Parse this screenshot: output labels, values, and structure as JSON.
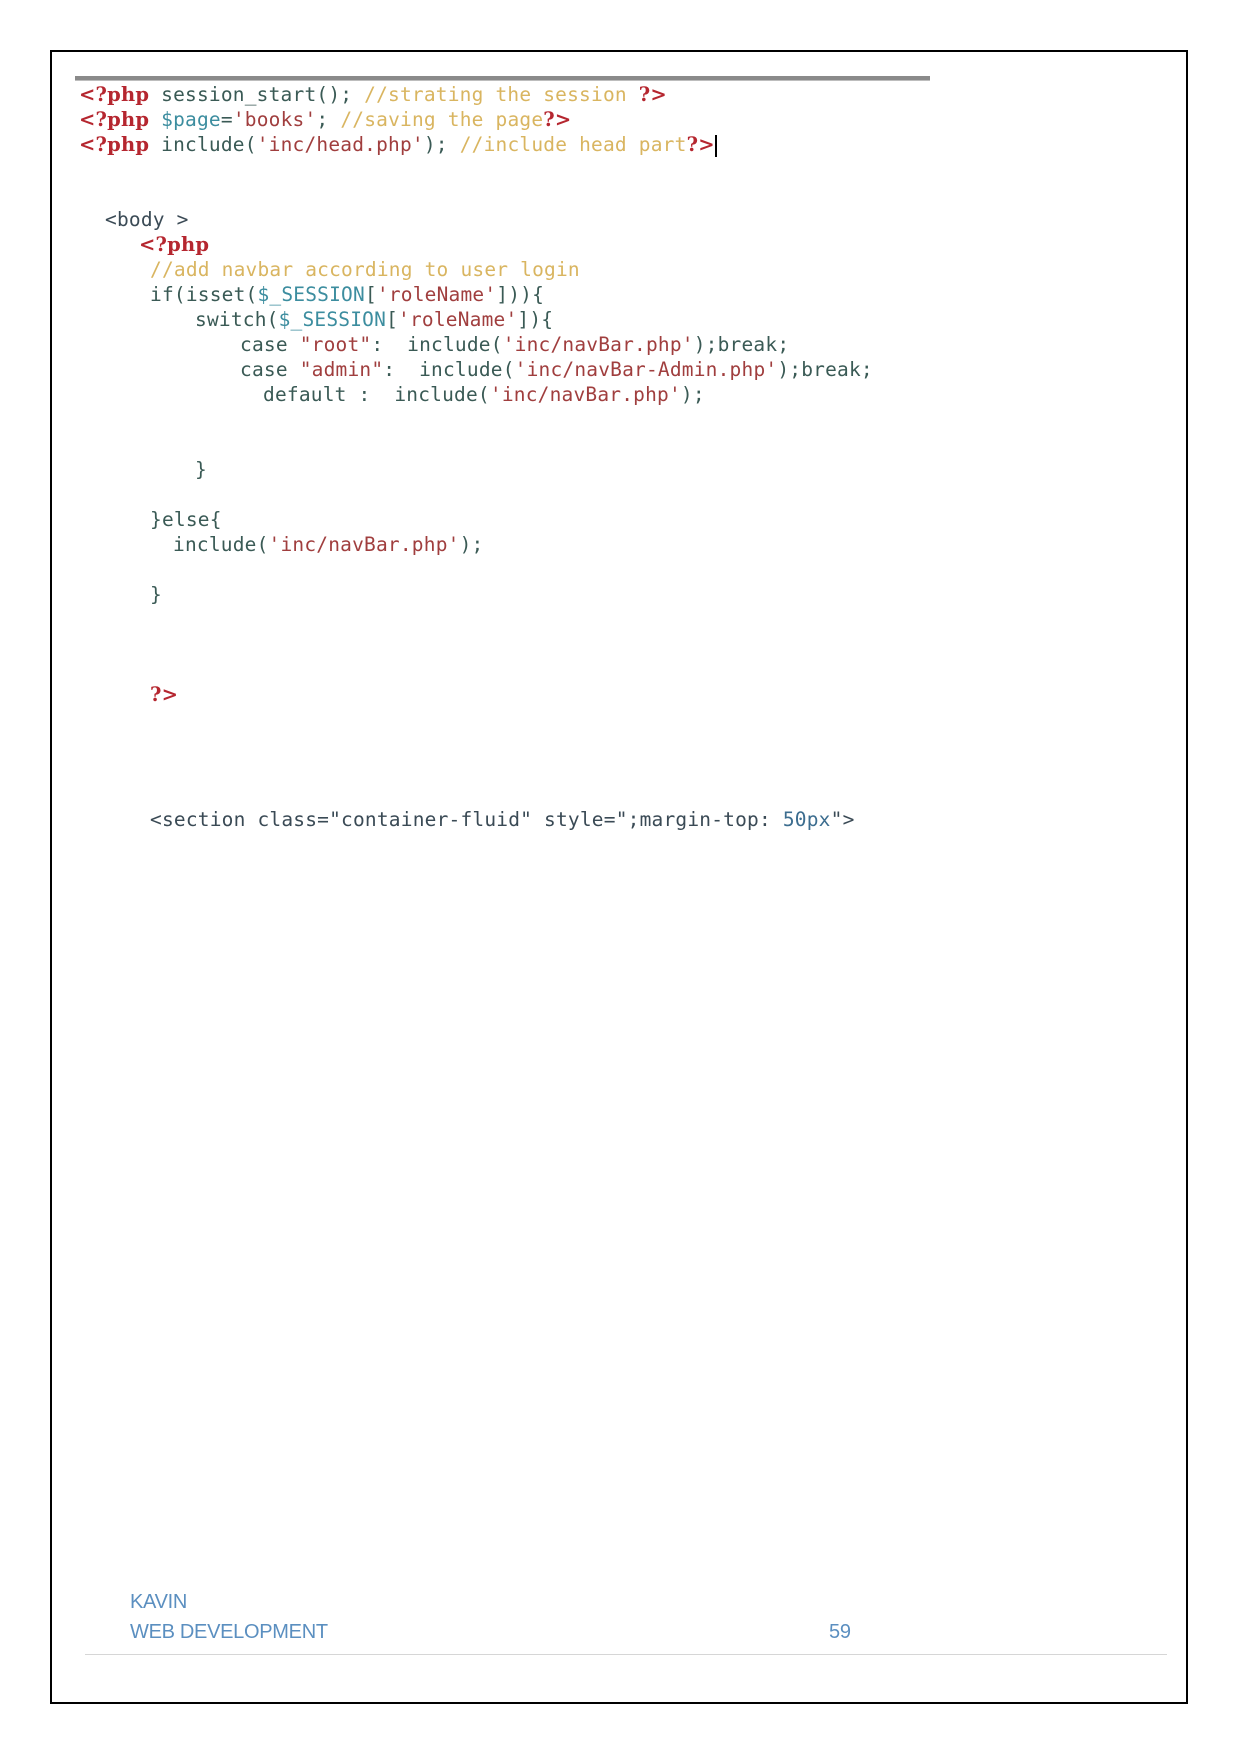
{
  "document": {
    "code_screenshot": {
      "lines": [
        {
          "tokens": [
            {
              "t": "<?php",
              "k": "php"
            },
            {
              "t": " session_start(); ",
              "k": "code"
            },
            {
              "t": "//strating the session ",
              "k": "cmt"
            },
            {
              "t": "?>",
              "k": "php"
            }
          ]
        },
        {
          "tokens": [
            {
              "t": "<?php",
              "k": "php"
            },
            {
              "t": " ",
              "k": "code"
            },
            {
              "t": "$page",
              "k": "var"
            },
            {
              "t": "=",
              "k": "code"
            },
            {
              "t": "'books'",
              "k": "str"
            },
            {
              "t": "; ",
              "k": "code"
            },
            {
              "t": "//saving the page",
              "k": "cmt"
            },
            {
              "t": "?>",
              "k": "php"
            }
          ]
        },
        {
          "tokens": [
            {
              "t": "<?php",
              "k": "php"
            },
            {
              "t": " include(",
              "k": "code"
            },
            {
              "t": "'inc/head.php'",
              "k": "str"
            },
            {
              "t": "); ",
              "k": "code"
            },
            {
              "t": "//include head part",
              "k": "cmt"
            },
            {
              "t": "?>",
              "k": "php"
            }
          ],
          "caret": true
        },
        {
          "tokens": [
            {
              "t": "<body >",
              "k": "html"
            }
          ]
        },
        {
          "tokens": [
            {
              "t": "<?php",
              "k": "php"
            }
          ]
        },
        {
          "tokens": [
            {
              "t": "//add navbar according to user login",
              "k": "cmt"
            }
          ]
        },
        {
          "tokens": [
            {
              "t": "if(isset(",
              "k": "code"
            },
            {
              "t": "$_SESSION",
              "k": "var"
            },
            {
              "t": "[",
              "k": "code"
            },
            {
              "t": "'roleName'",
              "k": "str"
            },
            {
              "t": "])){",
              "k": "code"
            }
          ]
        },
        {
          "tokens": [
            {
              "t": "switch(",
              "k": "code"
            },
            {
              "t": "$_SESSION",
              "k": "var"
            },
            {
              "t": "[",
              "k": "code"
            },
            {
              "t": "'roleName'",
              "k": "str"
            },
            {
              "t": "]){",
              "k": "code"
            }
          ]
        },
        {
          "tokens": [
            {
              "t": "case ",
              "k": "code"
            },
            {
              "t": "\"root\"",
              "k": "str"
            },
            {
              "t": ":  include(",
              "k": "code"
            },
            {
              "t": "'inc/navBar.php'",
              "k": "str"
            },
            {
              "t": ");break;",
              "k": "code"
            }
          ]
        },
        {
          "tokens": [
            {
              "t": "case ",
              "k": "code"
            },
            {
              "t": "\"admin\"",
              "k": "str"
            },
            {
              "t": ":  include(",
              "k": "code"
            },
            {
              "t": "'inc/navBar-Admin.php'",
              "k": "str"
            },
            {
              "t": ");break;",
              "k": "code"
            }
          ]
        },
        {
          "tokens": [
            {
              "t": "default :  include(",
              "k": "code"
            },
            {
              "t": "'inc/navBar.php'",
              "k": "str"
            },
            {
              "t": ");",
              "k": "code"
            }
          ]
        },
        {
          "tokens": [
            {
              "t": "}",
              "k": "code"
            }
          ]
        },
        {
          "tokens": [
            {
              "t": "}else{",
              "k": "code"
            }
          ]
        },
        {
          "tokens": [
            {
              "t": "include(",
              "k": "code"
            },
            {
              "t": "'inc/navBar.php'",
              "k": "str"
            },
            {
              "t": ");",
              "k": "code"
            }
          ]
        },
        {
          "tokens": [
            {
              "t": "}",
              "k": "code"
            }
          ]
        },
        {
          "tokens": [
            {
              "t": "?>",
              "k": "php"
            }
          ]
        },
        {
          "tokens": [
            {
              "t": "<section class=",
              "k": "html"
            },
            {
              "t": "\"container-fluid\"",
              "k": "html"
            },
            {
              "t": " style=",
              "k": "html"
            },
            {
              "t": "\";margin-top: ",
              "k": "html"
            },
            {
              "t": "50px",
              "k": "num"
            },
            {
              "t": "\">",
              "k": "html"
            }
          ]
        }
      ]
    },
    "footer": {
      "author": "KAVIN",
      "subject": "WEB DEVELOPMENT",
      "page_number": "59"
    },
    "colors": {
      "php_tag": "#b5262f",
      "comment": "#d9b560",
      "variable": "#3c8d9f",
      "string": "#a03e3e",
      "code": "#3a5a55",
      "footer_text": "#5b8fc0"
    }
  }
}
